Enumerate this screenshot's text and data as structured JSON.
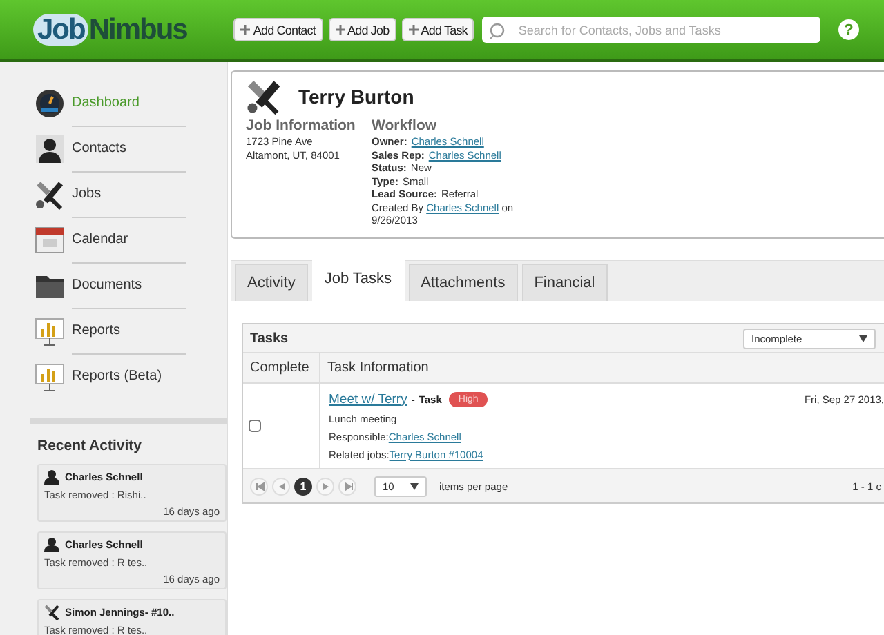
{
  "header": {
    "logo": {
      "first": "Job",
      "second": "Nimbus"
    },
    "actions": [
      "Add Contact",
      "Add Job",
      "Add Task"
    ],
    "search": {
      "placeholder": "Search for Contacts, Jobs and Tasks"
    },
    "help": "?"
  },
  "sidebar": {
    "items": [
      {
        "label": "Dashboard",
        "kind": "dashboard",
        "selected": true
      },
      {
        "label": "Contacts",
        "kind": "contacts",
        "selected": false
      },
      {
        "label": "Jobs",
        "kind": "jobs",
        "selected": false
      },
      {
        "label": "Calendar",
        "kind": "calendar",
        "selected": false
      },
      {
        "label": "Documents",
        "kind": "documents",
        "selected": false
      },
      {
        "label": "Reports",
        "kind": "reports",
        "selected": false
      },
      {
        "label": "Reports (Beta)",
        "kind": "reports",
        "selected": false
      }
    ],
    "recent_activity": {
      "title": "Recent Activity",
      "items": [
        {
          "kind": "contact",
          "author": "Charles Schnell",
          "text": "Task removed : Rishi..",
          "time": "16 days ago"
        },
        {
          "kind": "contact",
          "author": "Charles Schnell",
          "text": "Task removed : R tes..",
          "time": "16 days ago"
        },
        {
          "kind": "job",
          "author": "Simon Jennings- #10..",
          "text": "Task removed : R tes.."
        }
      ]
    }
  },
  "job": {
    "title": "Terry Burton",
    "info": {
      "heading": "Job Information",
      "lines": [
        "1723 Pine Ave",
        "Altamont, UT, 84001"
      ]
    },
    "workflow": {
      "heading": "Workflow",
      "fields": [
        {
          "label": "Owner:",
          "value": "Charles Schnell",
          "link": true
        },
        {
          "label": "Sales Rep:",
          "value": "Charles Schnell",
          "link": true
        },
        {
          "label": "Status:",
          "value": "New",
          "link": false
        },
        {
          "label": "Type:",
          "value": "Small",
          "link": false
        },
        {
          "label": "Lead Source:",
          "value": "Referral",
          "link": false
        }
      ],
      "created": {
        "prefix": "Created By",
        "link": "Charles Schnell",
        "suffix": "on 9/26/2013"
      }
    }
  },
  "tabs": [
    {
      "label": "Activity",
      "selected": false
    },
    {
      "label": "Job Tasks",
      "selected": true
    },
    {
      "label": "Attachments",
      "selected": false
    },
    {
      "label": "Financial",
      "selected": false
    }
  ],
  "tasks": {
    "title": "Tasks",
    "filter": "Incomplete",
    "columns": [
      "Complete",
      "Task Information"
    ],
    "rows": [
      {
        "checked": false,
        "title": "Meet w/ Terry",
        "separator": "-",
        "type": "Task",
        "priority": {
          "label": "High",
          "color": "#e05252"
        },
        "description": "Lunch meeting",
        "responsible_label": "Responsible:",
        "responsible": "Charles Schnell",
        "related_label": "Related jobs:",
        "related": "Terry Burton #10004",
        "date": "Fri, Sep 27 2013,"
      }
    ],
    "pager": {
      "buttons": [
        {
          "kind": "first"
        },
        {
          "kind": "prev"
        },
        {
          "kind": "page",
          "label": "1",
          "selected": true
        },
        {
          "kind": "next"
        },
        {
          "kind": "last"
        }
      ],
      "page_size": "10",
      "page_size_label": "items per page",
      "summary": "1 - 1 c"
    }
  }
}
